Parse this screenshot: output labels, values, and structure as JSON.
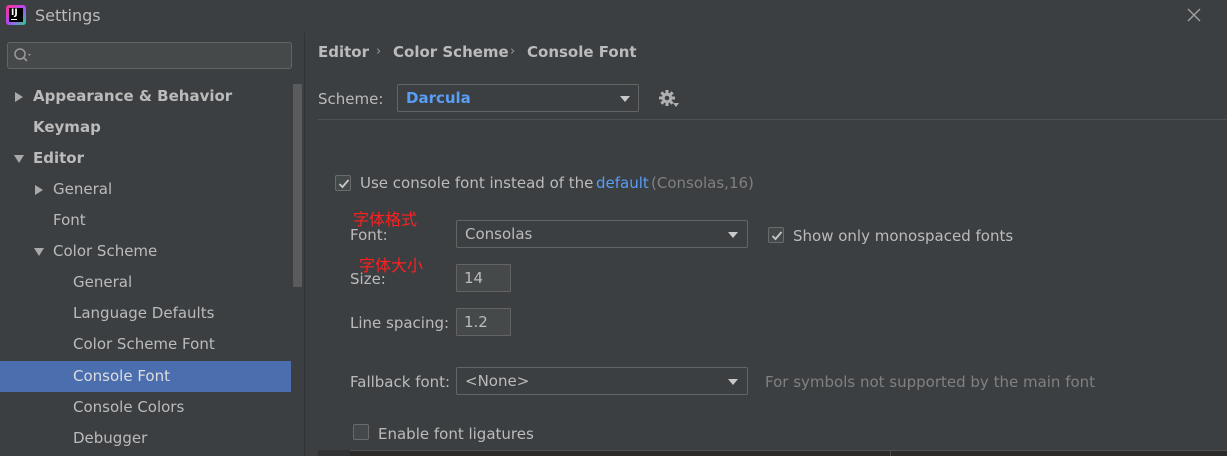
{
  "window": {
    "title": "Settings",
    "logo_text": "IJ"
  },
  "sidebar": {
    "search": {
      "value": "",
      "placeholder": ""
    },
    "items": [
      {
        "label": "Appearance & Behavior",
        "level": 0,
        "expandable": true,
        "expanded": false,
        "bold": true
      },
      {
        "label": "Keymap",
        "level": 0,
        "expandable": false,
        "bold": true
      },
      {
        "label": "Editor",
        "level": 0,
        "expandable": true,
        "expanded": true,
        "bold": true
      },
      {
        "label": "General",
        "level": 1,
        "expandable": true,
        "expanded": false
      },
      {
        "label": "Font",
        "level": 1,
        "expandable": false
      },
      {
        "label": "Color Scheme",
        "level": 1,
        "expandable": true,
        "expanded": true
      },
      {
        "label": "General",
        "level": 2
      },
      {
        "label": "Language Defaults",
        "level": 2
      },
      {
        "label": "Color Scheme Font",
        "level": 2
      },
      {
        "label": "Console Font",
        "level": 2,
        "selected": true
      },
      {
        "label": "Console Colors",
        "level": 2
      },
      {
        "label": "Debugger",
        "level": 2
      }
    ]
  },
  "breadcrumb": {
    "items": [
      "Editor",
      "Color Scheme",
      "Console Font"
    ],
    "separator": "›"
  },
  "scheme": {
    "label": "Scheme:",
    "value": "Darcula"
  },
  "console_font": {
    "use_console_font_checked": true,
    "use_console_font_label": "Use console font instead of the",
    "default_link": "default",
    "default_detail": "(Consolas,16)",
    "font_label": "Font:",
    "font_value": "Consolas",
    "show_monospaced_checked": true,
    "show_monospaced_label": "Show only monospaced fonts",
    "size_label": "Size:",
    "size_value": "14",
    "line_spacing_label": "Line spacing:",
    "line_spacing_value": "1.2",
    "fallback_label": "Fallback font:",
    "fallback_value": "<None>",
    "fallback_hint": "For symbols not supported by the main font",
    "ligatures_checked": false,
    "ligatures_label": "Enable font ligatures"
  },
  "annotations": {
    "font_note": "字体格式",
    "size_note": "字体大小"
  },
  "colors": {
    "background": "#3c3f41",
    "selection": "#4b6eaf",
    "link": "#589df6",
    "annotation": "#ff2020",
    "text": "#bbbbbb"
  }
}
